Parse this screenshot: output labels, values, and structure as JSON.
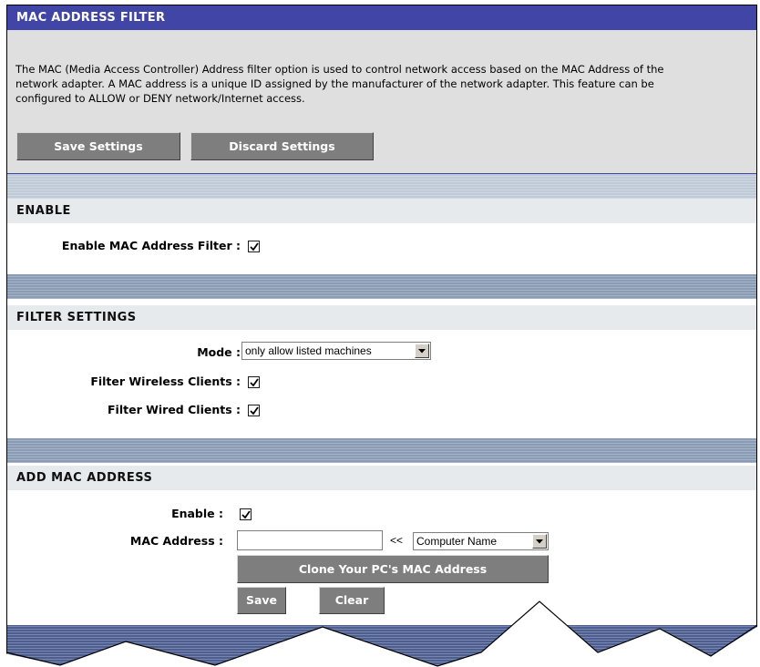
{
  "header": {
    "title": "MAC ADDRESS FILTER"
  },
  "intro": {
    "line1": "The MAC (Media Access Controller) Address filter option is used to control network access based on the MAC Address of the",
    "line2": "network adapter. A MAC address is a unique ID assigned by the manufacturer of the network adapter. This feature can be",
    "line3": "configured to ALLOW or DENY network/Internet access."
  },
  "buttons": {
    "save_settings": "Save Settings",
    "discard_settings": "Discard Settings"
  },
  "enable_section": {
    "title": "ENABLE",
    "enable_label": "Enable MAC Address Filter :",
    "enable_checked": true
  },
  "filter_section": {
    "title": "FILTER SETTINGS",
    "mode_label": "Mode :",
    "mode_value": "only allow listed machines",
    "wireless_label": "Filter Wireless Clients :",
    "wireless_checked": true,
    "wired_label": "Filter Wired Clients :",
    "wired_checked": true
  },
  "add_section": {
    "title": "ADD MAC ADDRESS",
    "enable_label": "Enable :",
    "enable_checked": true,
    "mac_label": "MAC Address :",
    "mac_value": "",
    "arrow_text": "<<",
    "computer_name_value": "Computer Name",
    "clone_label": "Clone Your PC's MAC Address",
    "save_label": "Save",
    "clear_label": "Clear"
  },
  "colors": {
    "header_blue": "#4145a6",
    "button_gray": "#7e7e7e",
    "section_bg": "#e6eaec"
  },
  "icons": {
    "checkbox": "checkmark-icon",
    "dropdown": "chevron-down-icon"
  }
}
